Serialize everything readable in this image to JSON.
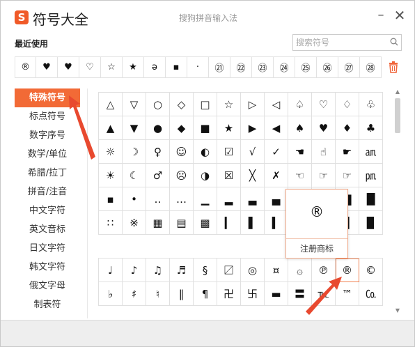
{
  "window": {
    "app_title": "符号大全",
    "ime_title": "搜狗拼音输入法",
    "logo_glyph": "S",
    "minimize": "–",
    "close": "✕"
  },
  "recent": {
    "label": "最近使用",
    "symbols": [
      "®",
      "♥",
      "♥",
      "♡",
      "☆",
      "★",
      "ə",
      "▪",
      "·",
      "㉑",
      "㉒",
      "㉓",
      "㉔",
      "㉕",
      "㉖",
      "㉗",
      "㉘"
    ]
  },
  "search": {
    "placeholder": "搜索符号",
    "value": ""
  },
  "sidebar": {
    "items": [
      "特殊符号",
      "标点符号",
      "数字序号",
      "数学/单位",
      "希腊/拉丁",
      "拼音/注音",
      "中文字符",
      "英文音标",
      "日文字符",
      "韩文字符",
      "俄文字母",
      "制表符"
    ],
    "active_index": 0
  },
  "grid1": {
    "rows": [
      [
        "△",
        "▽",
        "○",
        "◇",
        "□",
        "☆",
        "▷",
        "◁",
        "♤",
        "♡",
        "♢",
        "♧"
      ],
      [
        "▲",
        "▼",
        "●",
        "◆",
        "■",
        "★",
        "▶",
        "◀",
        "♠",
        "♥",
        "♦",
        "♣"
      ],
      [
        "☼",
        "☽",
        "♀",
        "☺",
        "◐",
        "☑",
        "√",
        "✓",
        "☚",
        "☝",
        "☛",
        "㏂"
      ],
      [
        "☀",
        "☾",
        "♂",
        "☹",
        "◑",
        "☒",
        "╳",
        "✗",
        "☜",
        "☞",
        "☞",
        "㏘"
      ],
      [
        "▪",
        "•",
        "‥",
        "…",
        "▁",
        "▂",
        "▃",
        "▄",
        "▅",
        "▆",
        "▇",
        "█"
      ],
      [
        "∷",
        "※",
        "▦",
        "▤",
        "▩",
        "▎",
        "▌",
        "▍",
        "▐",
        "▋",
        "▊",
        "▉"
      ]
    ]
  },
  "grid2": {
    "rows": [
      [
        "♩",
        "♪",
        "♫",
        "♬",
        "§",
        "〼",
        "◎",
        "¤",
        "۞",
        "℗",
        "®",
        "©"
      ],
      [
        "♭",
        "♯",
        "♮",
        "‖",
        "¶",
        "卍",
        "卐",
        "▬",
        "〓",
        "℡",
        "™",
        "㏇"
      ]
    ],
    "highlight": [
      0,
      10
    ]
  },
  "tooltip": {
    "glyph": "®",
    "label": "注册商标"
  },
  "colors": {
    "accent": "#f26a36",
    "arrow": "#e8492f"
  }
}
